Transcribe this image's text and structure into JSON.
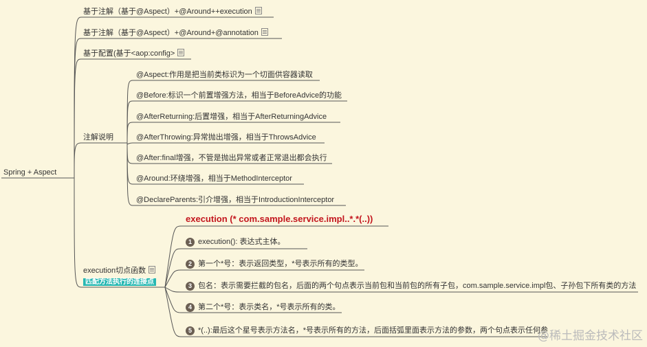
{
  "root": "Spring + Aspect",
  "branches": [
    "基于注解（基于@Aspect）+@Around++execution",
    "基于注解（基于@Aspect）+@Around+@annotation",
    "基于配置(基于<aop:config>",
    "注解说明",
    "execution切点函数"
  ],
  "execution_tag": "匹配方法执行的连接点",
  "annotations": [
    "@Aspect:作用是把当前类标识为一个切面供容器读取",
    "@Before:标识一个前置增强方法，相当于BeforeAdvice的功能",
    "@AfterReturning:后置增强，相当于AfterReturningAdvice",
    "@AfterThrowing:异常抛出增强，相当于ThrowsAdvice",
    "@After:final增强，不管是抛出异常或者正常退出都会执行",
    "@Around:环绕增强，相当于MethodInterceptor",
    "@DeclareParents:引介增强，相当于IntroductionInterceptor"
  ],
  "execution_title": "execution (* com.sample.service.impl..*.*(..))",
  "execution_items": [
    {
      "num": "1",
      "text": "execution(): 表达式主体。"
    },
    {
      "num": "2",
      "text": "第一个*号：表示返回类型，*号表示所有的类型。"
    },
    {
      "num": "3",
      "text": "包名：表示需要拦截的包名，后面的两个句点表示当前包和当前包的所有子包，com.sample.service.impl包、子孙包下所有类的方法"
    },
    {
      "num": "4",
      "text": "第二个*号：表示类名，*号表示所有的类。"
    },
    {
      "num": "5",
      "text": "*(..):最后这个星号表示方法名，*号表示所有的方法，后面括弧里面表示方法的参数，两个句点表示任何参"
    }
  ],
  "watermark": "@稀土掘金技术社区",
  "colors": {
    "background": "#fbf6de",
    "line": "#555555",
    "red": "#c3151d",
    "badge": "#27b8b3",
    "number": "#6b5f53"
  }
}
